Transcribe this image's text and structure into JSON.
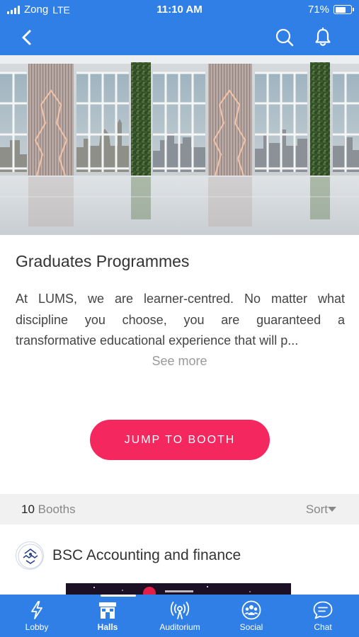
{
  "status_bar": {
    "carrier": "Zong",
    "network": "LTE",
    "time": "11:10 AM",
    "battery": "71%",
    "battery_level": 0.71
  },
  "nav": {
    "back_icon": "chevron-left-icon",
    "search_icon": "search-icon",
    "notification_icon": "bell-icon"
  },
  "hero": {
    "image": "virtual-hall-interior"
  },
  "programme": {
    "title": "Graduates Programmes",
    "description": "At LUMS, we are learner-centred. No matter what discipline you choose, you are guaranteed a transformative educational experience that will p...",
    "see_more": "See more"
  },
  "cta": {
    "label": "JUMP TO BOOTH",
    "color": "#f5275f"
  },
  "booths": {
    "count": "10",
    "count_label": "Booths",
    "sort_label": "Sort",
    "items": [
      {
        "name": "BSC Accounting and finance",
        "logo": "lums-logo"
      }
    ]
  },
  "tabs": [
    {
      "label": "Lobby",
      "icon": "lightning-icon",
      "active": false
    },
    {
      "label": "Halls",
      "icon": "halls-icon",
      "active": true
    },
    {
      "label": "Auditorium",
      "icon": "broadcast-icon",
      "active": false
    },
    {
      "label": "Social",
      "icon": "people-icon",
      "active": false
    },
    {
      "label": "Chat",
      "icon": "chat-icon",
      "active": false
    }
  ],
  "colors": {
    "primary": "#2f7fe6",
    "accent": "#f5275f"
  }
}
